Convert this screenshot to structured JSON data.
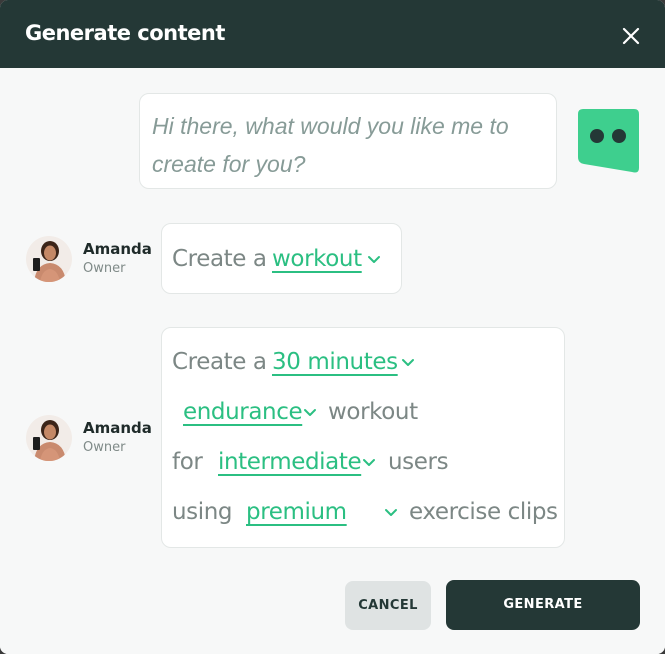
{
  "dialog": {
    "title": "Generate content",
    "close_icon": "close-icon"
  },
  "bot": {
    "line1": "Hi there, what would you like me to",
    "line2": "create for you?",
    "icon": "robot-face-icon",
    "accent_color": "#3ecf8e"
  },
  "messages": [
    {
      "user": {
        "name": "Amanda",
        "role": "Owner"
      },
      "prefix": "Create a",
      "selection": "workout"
    },
    {
      "user": {
        "name": "Amanda",
        "role": "Owner"
      },
      "line1_prefix": "Create a",
      "duration": "30 minutes",
      "type": "endurance",
      "line2_suffix": "workout",
      "line3_prefix": "for",
      "level": "intermediate",
      "line3_suffix": "users",
      "line4_prefix": "using",
      "tier": "premium",
      "line4_suffix": "exercise clips"
    }
  ],
  "buttons": {
    "cancel": "CANCEL",
    "generate": "GENERATE"
  },
  "colors": {
    "header_bg": "#243836",
    "accent_green": "#2bbf82"
  }
}
